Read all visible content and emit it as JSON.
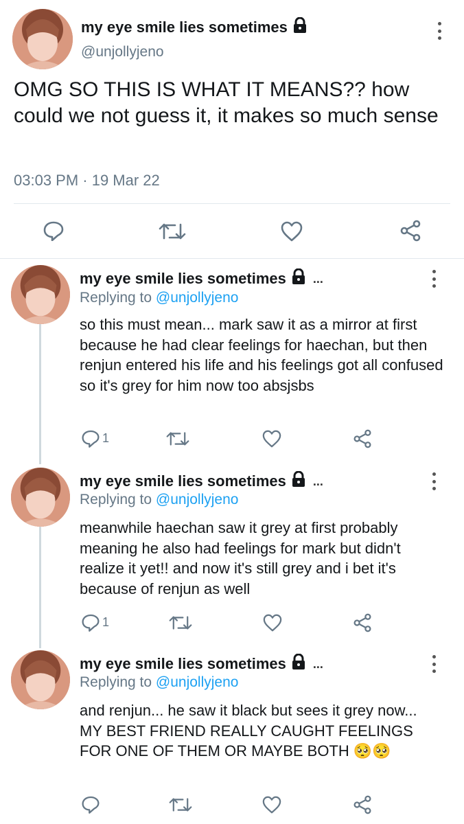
{
  "main_tweet": {
    "display_name": "my eye smile lies sometimes",
    "handle": "@unjollyjeno",
    "text": "OMG SO THIS IS WHAT IT MEANS?? how could we not guess it, it makes so much sense",
    "timestamp": "03:03 PM · 19 Mar 22",
    "actions": [
      "reply-icon",
      "retweet-icon",
      "like-icon",
      "share-icon"
    ]
  },
  "replies": [
    {
      "display_name": "my eye smile lies sometimes",
      "ellipsis": "...",
      "replying_prefix": "Replying to",
      "replying_to": "@unjollyjeno",
      "text": "so this must mean... mark saw it as a mirror at first because he had clear feelings for haechan, but then renjun entered his life and his feelings got all confused so it's grey for him now too absjsbs",
      "reply_count": "1"
    },
    {
      "display_name": "my eye smile lies sometimes",
      "ellipsis": "...",
      "replying_prefix": "Replying to",
      "replying_to": "@unjollyjeno",
      "text": "meanwhile haechan saw it grey at first probably meaning he also had feelings for mark but didn't realize it yet!! and now it's still grey and i bet it's because of renjun as well",
      "reply_count": "1"
    },
    {
      "display_name": "my eye smile lies sometimes",
      "ellipsis": "...",
      "replying_prefix": "Replying to",
      "replying_to": "@unjollyjeno",
      "text": "and renjun... he saw it black but sees it grey now... MY BEST FRIEND REALLY CAUGHT FEELINGS FOR ONE OF THEM OR MAYBE BOTH 🥺🥺",
      "reply_count": ""
    }
  ],
  "colors": {
    "link": "#1da1f2",
    "secondary": "#657786",
    "divider": "#e1e8ed",
    "thread_line": "#cfd9de"
  }
}
